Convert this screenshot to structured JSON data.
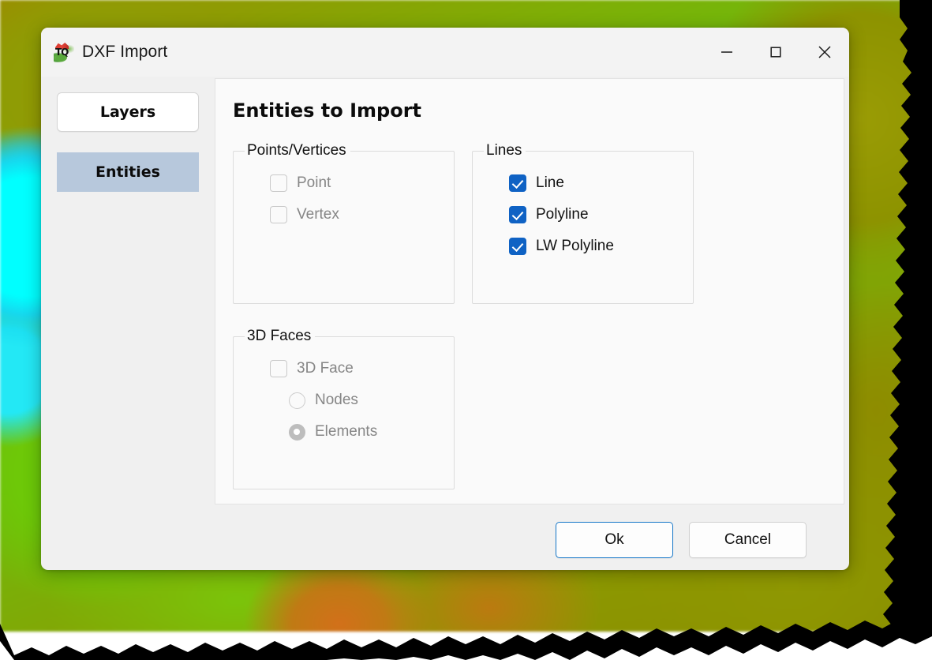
{
  "window": {
    "title": "DXF Import",
    "icon": "app-terrain-icon",
    "controls": {
      "minimize": "minimize-icon",
      "maximize": "maximize-icon",
      "close": "close-icon"
    }
  },
  "sidebar": {
    "items": [
      {
        "label": "Layers",
        "selected": false
      },
      {
        "label": "Entities",
        "selected": true
      }
    ]
  },
  "panel": {
    "title": "Entities to Import",
    "groups": [
      {
        "legend": "Points/Vertices",
        "options": [
          {
            "type": "checkbox",
            "label": "Point",
            "checked": false,
            "disabled": true
          },
          {
            "type": "checkbox",
            "label": "Vertex",
            "checked": false,
            "disabled": true
          }
        ]
      },
      {
        "legend": "Lines",
        "options": [
          {
            "type": "checkbox",
            "label": "Line",
            "checked": true,
            "disabled": false
          },
          {
            "type": "checkbox",
            "label": "Polyline",
            "checked": true,
            "disabled": false
          },
          {
            "type": "checkbox",
            "label": "LW Polyline",
            "checked": true,
            "disabled": false
          }
        ]
      },
      {
        "legend": "3D Faces",
        "options": [
          {
            "type": "checkbox",
            "label": "3D Face",
            "checked": false,
            "disabled": true
          },
          {
            "type": "radio",
            "label": "Nodes",
            "checked": false,
            "disabled": true
          },
          {
            "type": "radio",
            "label": "Elements",
            "checked": true,
            "disabled": true
          }
        ]
      }
    ]
  },
  "footer": {
    "ok_label": "Ok",
    "cancel_label": "Cancel"
  },
  "colors": {
    "accent": "#0f62c4",
    "selected_nav": "#b7c8dc",
    "focus_border": "#1677c8",
    "window_bg": "#f0f0f0",
    "titlebar_bg": "#f3f3f3",
    "panel_bg": "#fafafa"
  }
}
